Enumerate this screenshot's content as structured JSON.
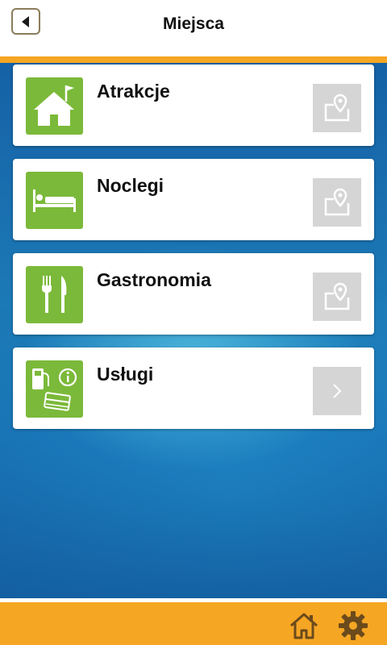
{
  "header": {
    "title": "Miejsca",
    "back_icon": "back-arrow-icon"
  },
  "categories": [
    {
      "label": "Atrakcje",
      "icon": "house-flag-icon",
      "action_icon": "map-pin-icon"
    },
    {
      "label": "Noclegi",
      "icon": "bed-icon",
      "action_icon": "map-pin-icon"
    },
    {
      "label": "Gastronomia",
      "icon": "fork-knife-icon",
      "action_icon": "map-pin-icon"
    },
    {
      "label": "Usługi",
      "icon": "services-icon",
      "action_icon": "chevron-right-icon"
    }
  ],
  "footer": {
    "home_icon": "home-icon",
    "settings_icon": "gear-icon"
  },
  "colors": {
    "accent": "#f5a623",
    "icon_green": "#7bb93a",
    "action_gray": "#d5d5d5",
    "background_blue": "#1f7fbf"
  }
}
